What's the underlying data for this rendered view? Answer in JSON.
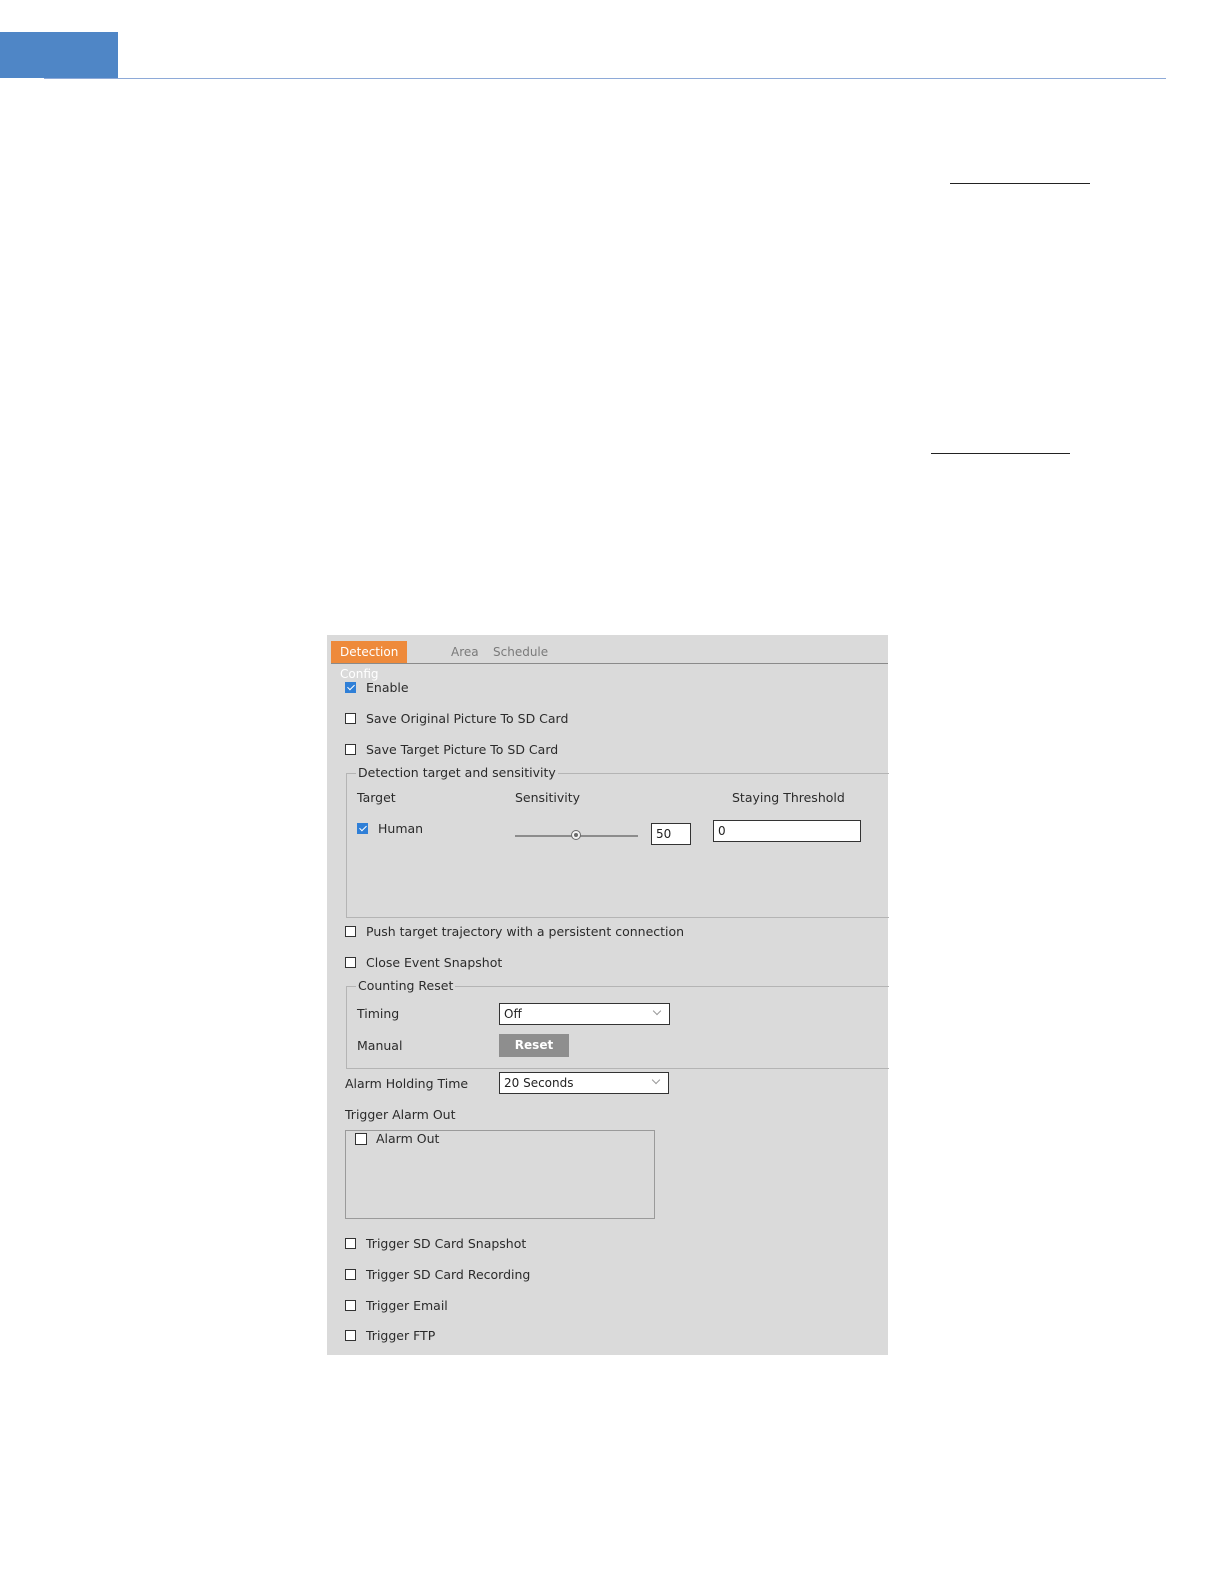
{
  "tabs": [
    {
      "label": "Detection Config",
      "active": true
    },
    {
      "label": "Area",
      "active": false
    },
    {
      "label": "Schedule",
      "active": false
    }
  ],
  "options_top": [
    {
      "label": "Enable",
      "checked": true
    },
    {
      "label": "Save Original Picture To SD Card",
      "checked": false
    },
    {
      "label": "Save Target Picture To SD Card",
      "checked": false
    }
  ],
  "detection_group": {
    "legend": "Detection target and sensitivity",
    "col_target": "Target",
    "col_sensitivity": "Sensitivity",
    "col_staying": "Staying Threshold",
    "rows": [
      {
        "target": "Human",
        "checked": true,
        "sensitivity": "50",
        "sensitivity_level": 50,
        "staying_threshold": "0"
      }
    ]
  },
  "options_mid": [
    {
      "label": "Push target trajectory with a persistent connection",
      "checked": false
    },
    {
      "label": "Close Event Snapshot",
      "checked": false
    }
  ],
  "counting_reset": {
    "legend": "Counting Reset",
    "timing_label": "Timing",
    "timing_value": "Off",
    "manual_label": "Manual",
    "reset_button": "Reset"
  },
  "alarm_holding": {
    "label": "Alarm Holding Time",
    "value": "20 Seconds"
  },
  "trigger_alarm_out": {
    "label": "Trigger Alarm Out",
    "items": [
      {
        "label": "Alarm Out",
        "checked": false
      }
    ]
  },
  "options_bottom": [
    {
      "label": "Trigger SD Card Snapshot",
      "checked": false
    },
    {
      "label": "Trigger SD Card Recording",
      "checked": false
    },
    {
      "label": "Trigger Email",
      "checked": false
    },
    {
      "label": "Trigger FTP",
      "checked": false
    }
  ],
  "colors": {
    "accent": "#ee8a3b",
    "check": "#2f7fd7",
    "panel_bg": "#dadada",
    "header_blue": "#4f86c6"
  }
}
